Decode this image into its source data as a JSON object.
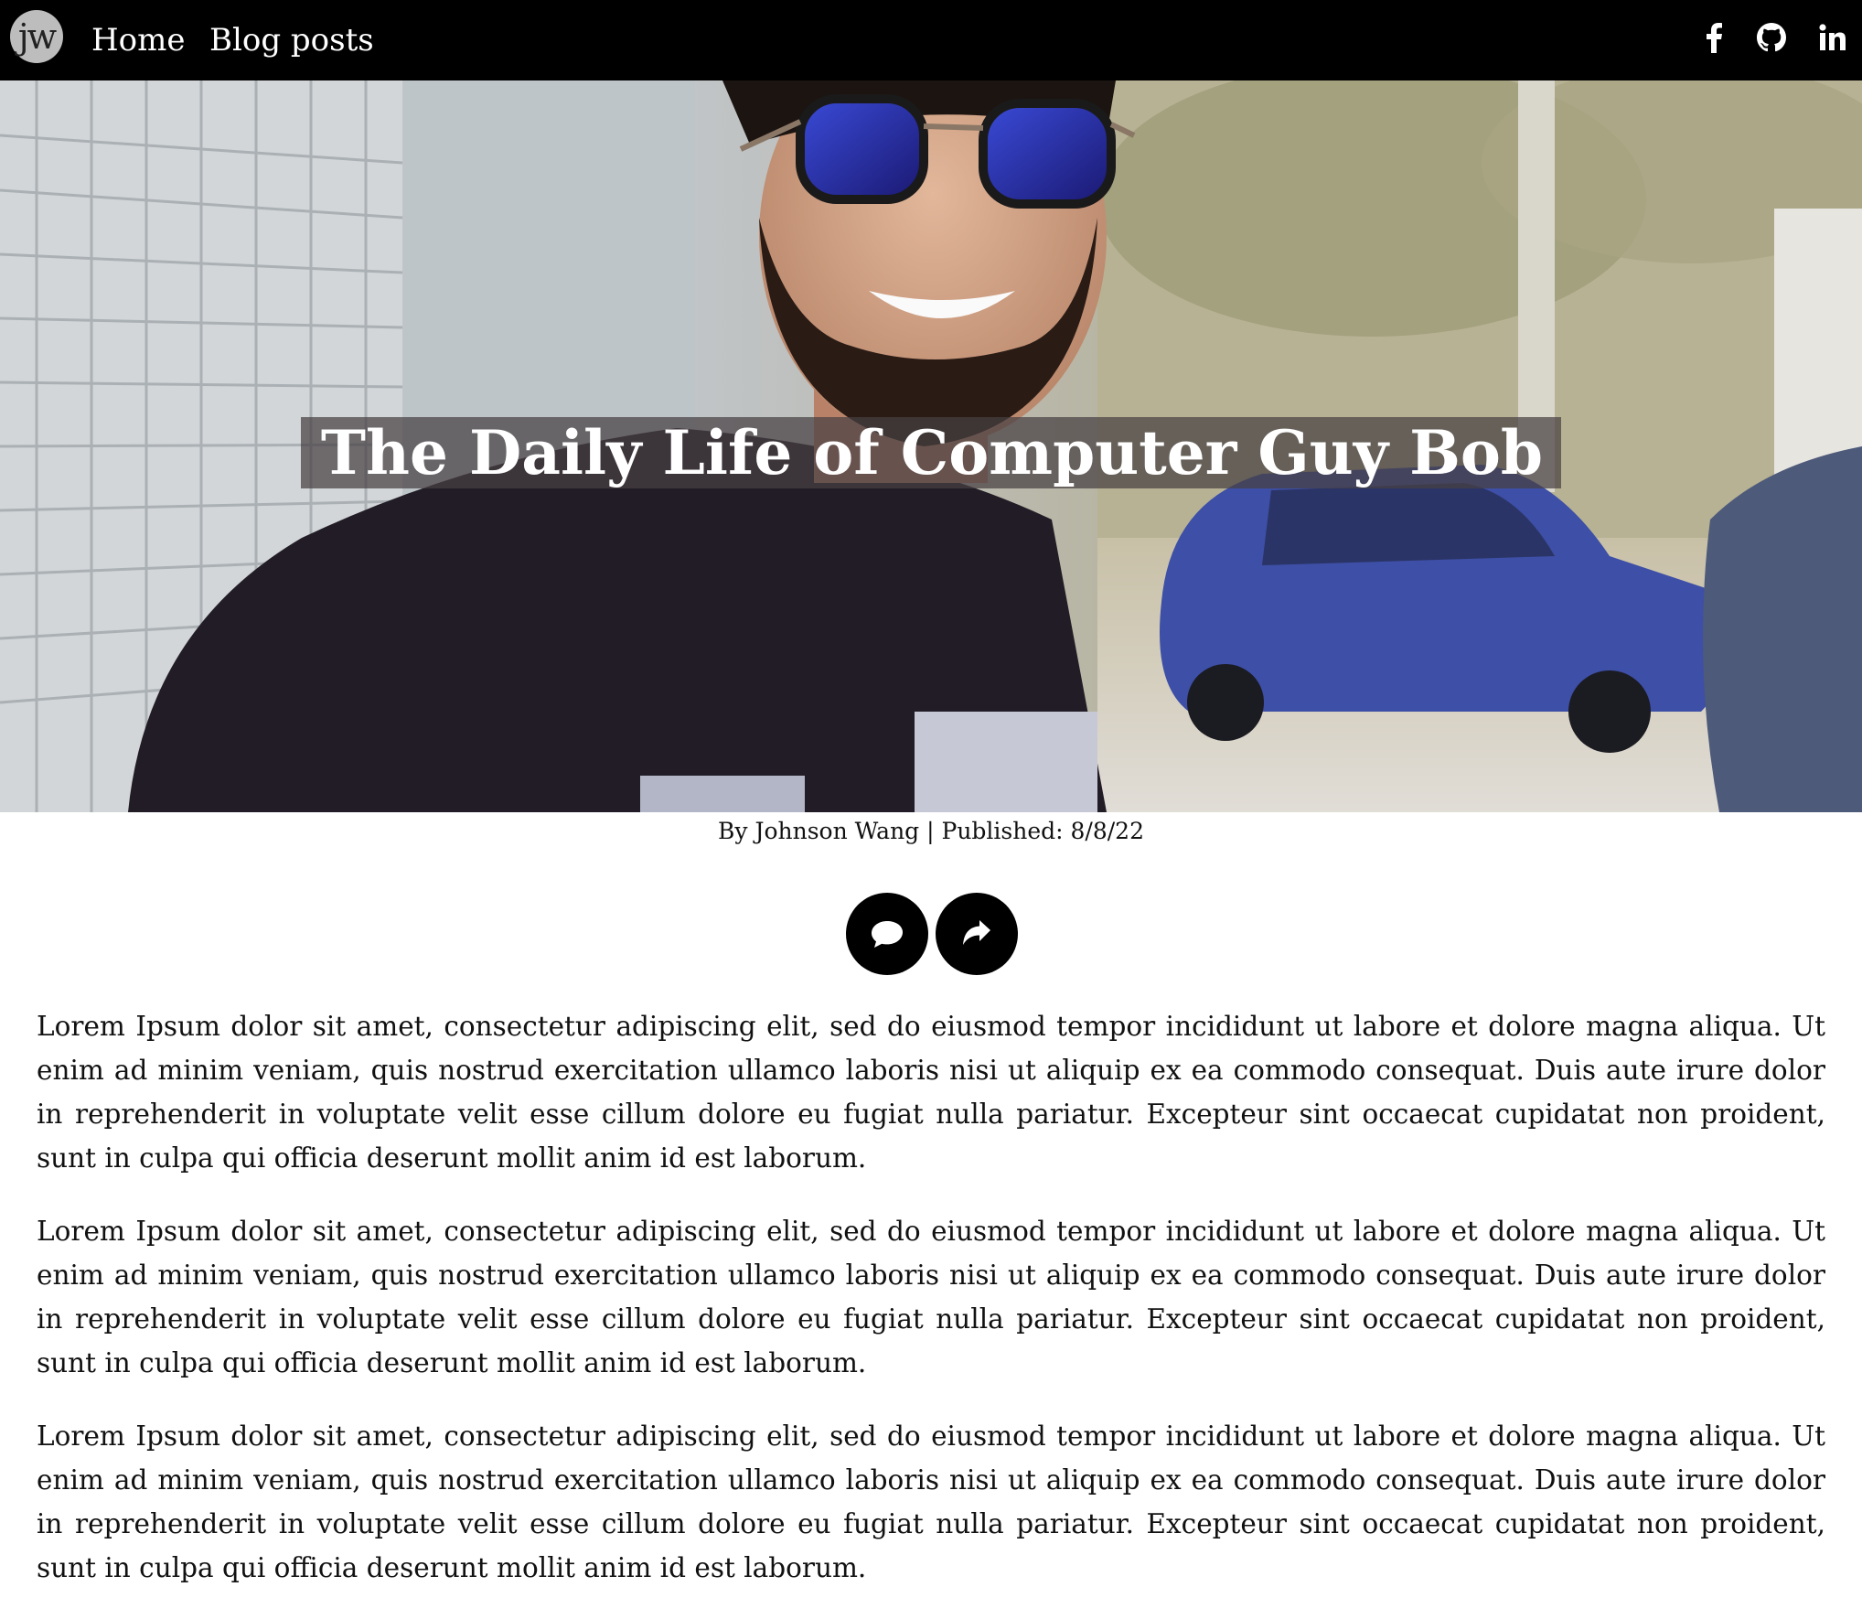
{
  "nav": {
    "logo_text": "jw",
    "links": [
      {
        "label": "Home"
      },
      {
        "label": "Blog posts"
      }
    ],
    "social_icons": [
      "facebook-icon",
      "github-icon",
      "linkedin-icon"
    ]
  },
  "hero": {
    "title": "The Daily Life of Computer Guy Bob"
  },
  "byline": {
    "text": "By Johnson Wang | Published: 8/8/22"
  },
  "actions": {
    "icons": [
      "comment-icon",
      "share-icon"
    ]
  },
  "article": {
    "paragraphs": [
      "Lorem Ipsum dolor sit amet, consectetur adipiscing elit, sed do eiusmod tempor incididunt ut labore et dolore magna aliqua. Ut enim ad minim veniam, quis nostrud exercitation ullamco laboris nisi ut aliquip ex ea commodo consequat. Duis aute irure dolor in reprehenderit in voluptate velit esse cillum dolore eu fugiat nulla pariatur. Excepteur sint occaecat cupidatat non proident, sunt in culpa qui officia deserunt mollit anim id est laborum.",
      "Lorem Ipsum dolor sit amet, consectetur adipiscing elit, sed do eiusmod tempor incididunt ut labore et dolore magna aliqua. Ut enim ad minim veniam, quis nostrud exercitation ullamco laboris nisi ut aliquip ex ea commodo consequat. Duis aute irure dolor in reprehenderit in voluptate velit esse cillum dolore eu fugiat nulla pariatur. Excepteur sint occaecat cupidatat non proident, sunt in culpa qui officia deserunt mollit anim id est laborum.",
      "Lorem Ipsum dolor sit amet, consectetur adipiscing elit, sed do eiusmod tempor incididunt ut labore et dolore magna aliqua. Ut enim ad minim veniam, quis nostrud exercitation ullamco laboris nisi ut aliquip ex ea commodo consequat. Duis aute irure dolor in reprehenderit in voluptate velit esse cillum dolore eu fugiat nulla pariatur. Excepteur sint occaecat cupidatat non proident, sunt in culpa qui officia deserunt mollit anim id est laborum."
    ]
  },
  "colors": {
    "navbar_bg": "#000000",
    "title_box_bg": "#464042",
    "button_bg": "#000000",
    "text": "#111111"
  }
}
